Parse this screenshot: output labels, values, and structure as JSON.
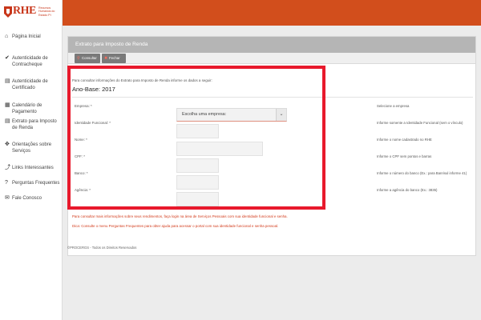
{
  "brand": {
    "logo_text": "RHE",
    "logo_sub": "Recursos Humanos do Estado PI"
  },
  "sidebar": {
    "items": [
      {
        "icon": "home-icon",
        "label": "Página Inicial"
      },
      {
        "icon": "check-circle-icon",
        "label": "Autenticidade de Contracheque"
      },
      {
        "icon": "document-icon",
        "label": "Autenticidade de Certificado"
      },
      {
        "icon": "calendar-icon",
        "label": "Calendário de Pagamento"
      },
      {
        "icon": "document-icon",
        "label": "Extrato para Imposto de Renda"
      },
      {
        "icon": "move-icon",
        "label": "Orientações sobre Serviços"
      },
      {
        "icon": "link-icon",
        "label": "Links Interessantes"
      },
      {
        "icon": "question-circle-icon",
        "label": "Perguntas Frequentes"
      },
      {
        "icon": "chat-icon",
        "label": "Fale Conosco"
      }
    ]
  },
  "main": {
    "title": "Extrato para Imposto de Renda",
    "buttons": {
      "consult": "Consultar",
      "close": "Fechar"
    },
    "intro": "Para consultar informações do Extrato para Imposto de Renda informe os dados a seguir:",
    "ano_base": "Ano-Base: 2017",
    "form": {
      "empresa_label": "Empresa: *",
      "empresa_value": "Escolha uma empresa:",
      "empresa_help": "Selecione a empresa",
      "idfunc_label": "Identidade Funcional: *",
      "idfunc_help": "Informe somente a Identidade Funcional (sem o vínculo)",
      "nome_label": "Nome: *",
      "nome_help": "Informe o nome cadastrado no RHE",
      "cpf_label": "CPF: *",
      "cpf_help": "Informe o CPF sem pontos e barras",
      "banco_label": "Banco: *",
      "banco_help": "Informe o número do banco (Ex.: para Banrisul informe 41)",
      "agencia_label": "Agência: *",
      "agencia_help": "Informe a agência do banco (Ex.: 3835)"
    },
    "notice1": "Para consultar mais informações sobre seus rendimentos, faça login na área de Serviços Pessoais com sua identidade funcional e senha.",
    "notice2": "Dica: Consulte o menu Perguntas Frequentes para obter ajuda para acessar o portal com sua identidade funcional e senha pessoal.",
    "footer": "©PROCERGS - Todos os Direitos Reservados"
  },
  "colors": {
    "accent": "#d24e1c",
    "highlight_frame": "#e8192c",
    "notice": "#d23a1a"
  }
}
